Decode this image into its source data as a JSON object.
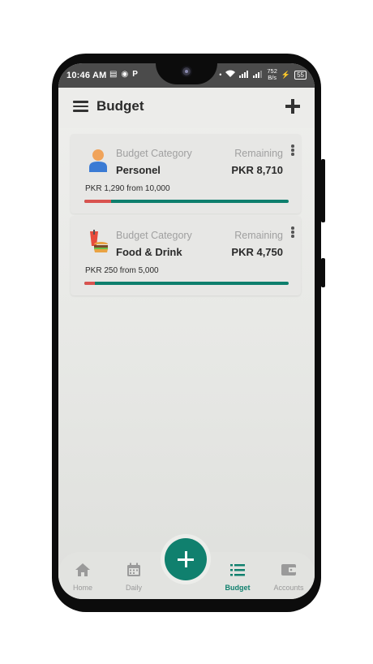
{
  "status_bar": {
    "time": "10:46 AM",
    "net_speed": "752",
    "net_unit": "B/s",
    "battery": "55"
  },
  "appbar": {
    "title": "Budget"
  },
  "budgets": [
    {
      "category_label": "Budget Category",
      "name": "Personel",
      "remaining_label": "Remaining",
      "remaining_value": "PKR 8,710",
      "progress_text": "PKR 1,290 from 10,000",
      "spent": 1290,
      "total": 10000,
      "icon": "person-icon"
    },
    {
      "category_label": "Budget Category",
      "name": "Food & Drink",
      "remaining_label": "Remaining",
      "remaining_value": "PKR 4,750",
      "progress_text": "PKR 250 from 5,000",
      "spent": 250,
      "total": 5000,
      "icon": "food-drink-icon"
    }
  ],
  "bottom_nav": {
    "items": [
      {
        "label": "Home",
        "icon": "home-icon",
        "active": false
      },
      {
        "label": "Daily",
        "icon": "calendar-icon",
        "active": false
      },
      {
        "label": "Budget",
        "icon": "list-icon",
        "active": true
      },
      {
        "label": "Accounts",
        "icon": "wallet-icon",
        "active": false
      }
    ]
  },
  "colors": {
    "accent": "#10806e",
    "progress_remaining": "#0e7f6d",
    "progress_spent": "#d9534f",
    "nav_inactive": "#9a9a9a"
  }
}
